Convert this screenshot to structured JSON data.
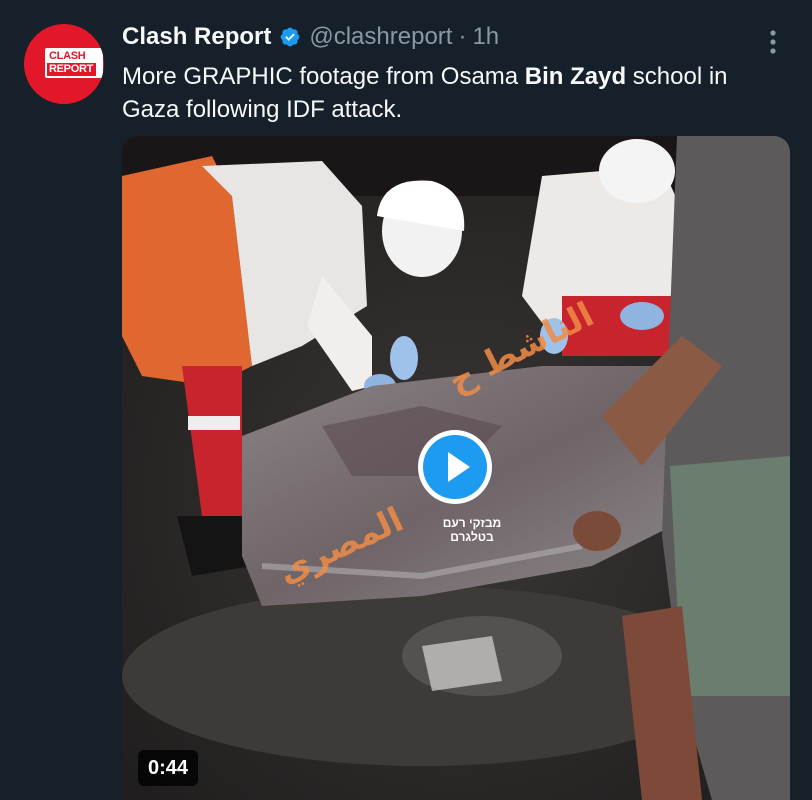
{
  "author": {
    "display_name": "Clash Report",
    "handle": "@clashreport",
    "separator": "·",
    "time": "1h",
    "avatar_text_top": "CLASH",
    "avatar_text_bottom": "REPORT"
  },
  "tweet": {
    "text_part1": "More GRAPHIC footage from Osama ",
    "text_bold": "Bin Zayd",
    "text_part2": " school in Gaza following IDF attack."
  },
  "media": {
    "duration": "0:44",
    "watermark_line1": "מבזקי רעם",
    "watermark_line2": "בטלגרם",
    "overlay_arabic_1": "الناشط ح",
    "overlay_arabic_2": "المصري"
  },
  "colors": {
    "background": "#15202b",
    "accent": "#1d9bf0",
    "avatar_red": "#e3172a",
    "muted_text": "#8b98a5"
  },
  "icons": {
    "verified": "verified-badge-icon",
    "more": "more-options-icon",
    "play": "play-icon"
  }
}
